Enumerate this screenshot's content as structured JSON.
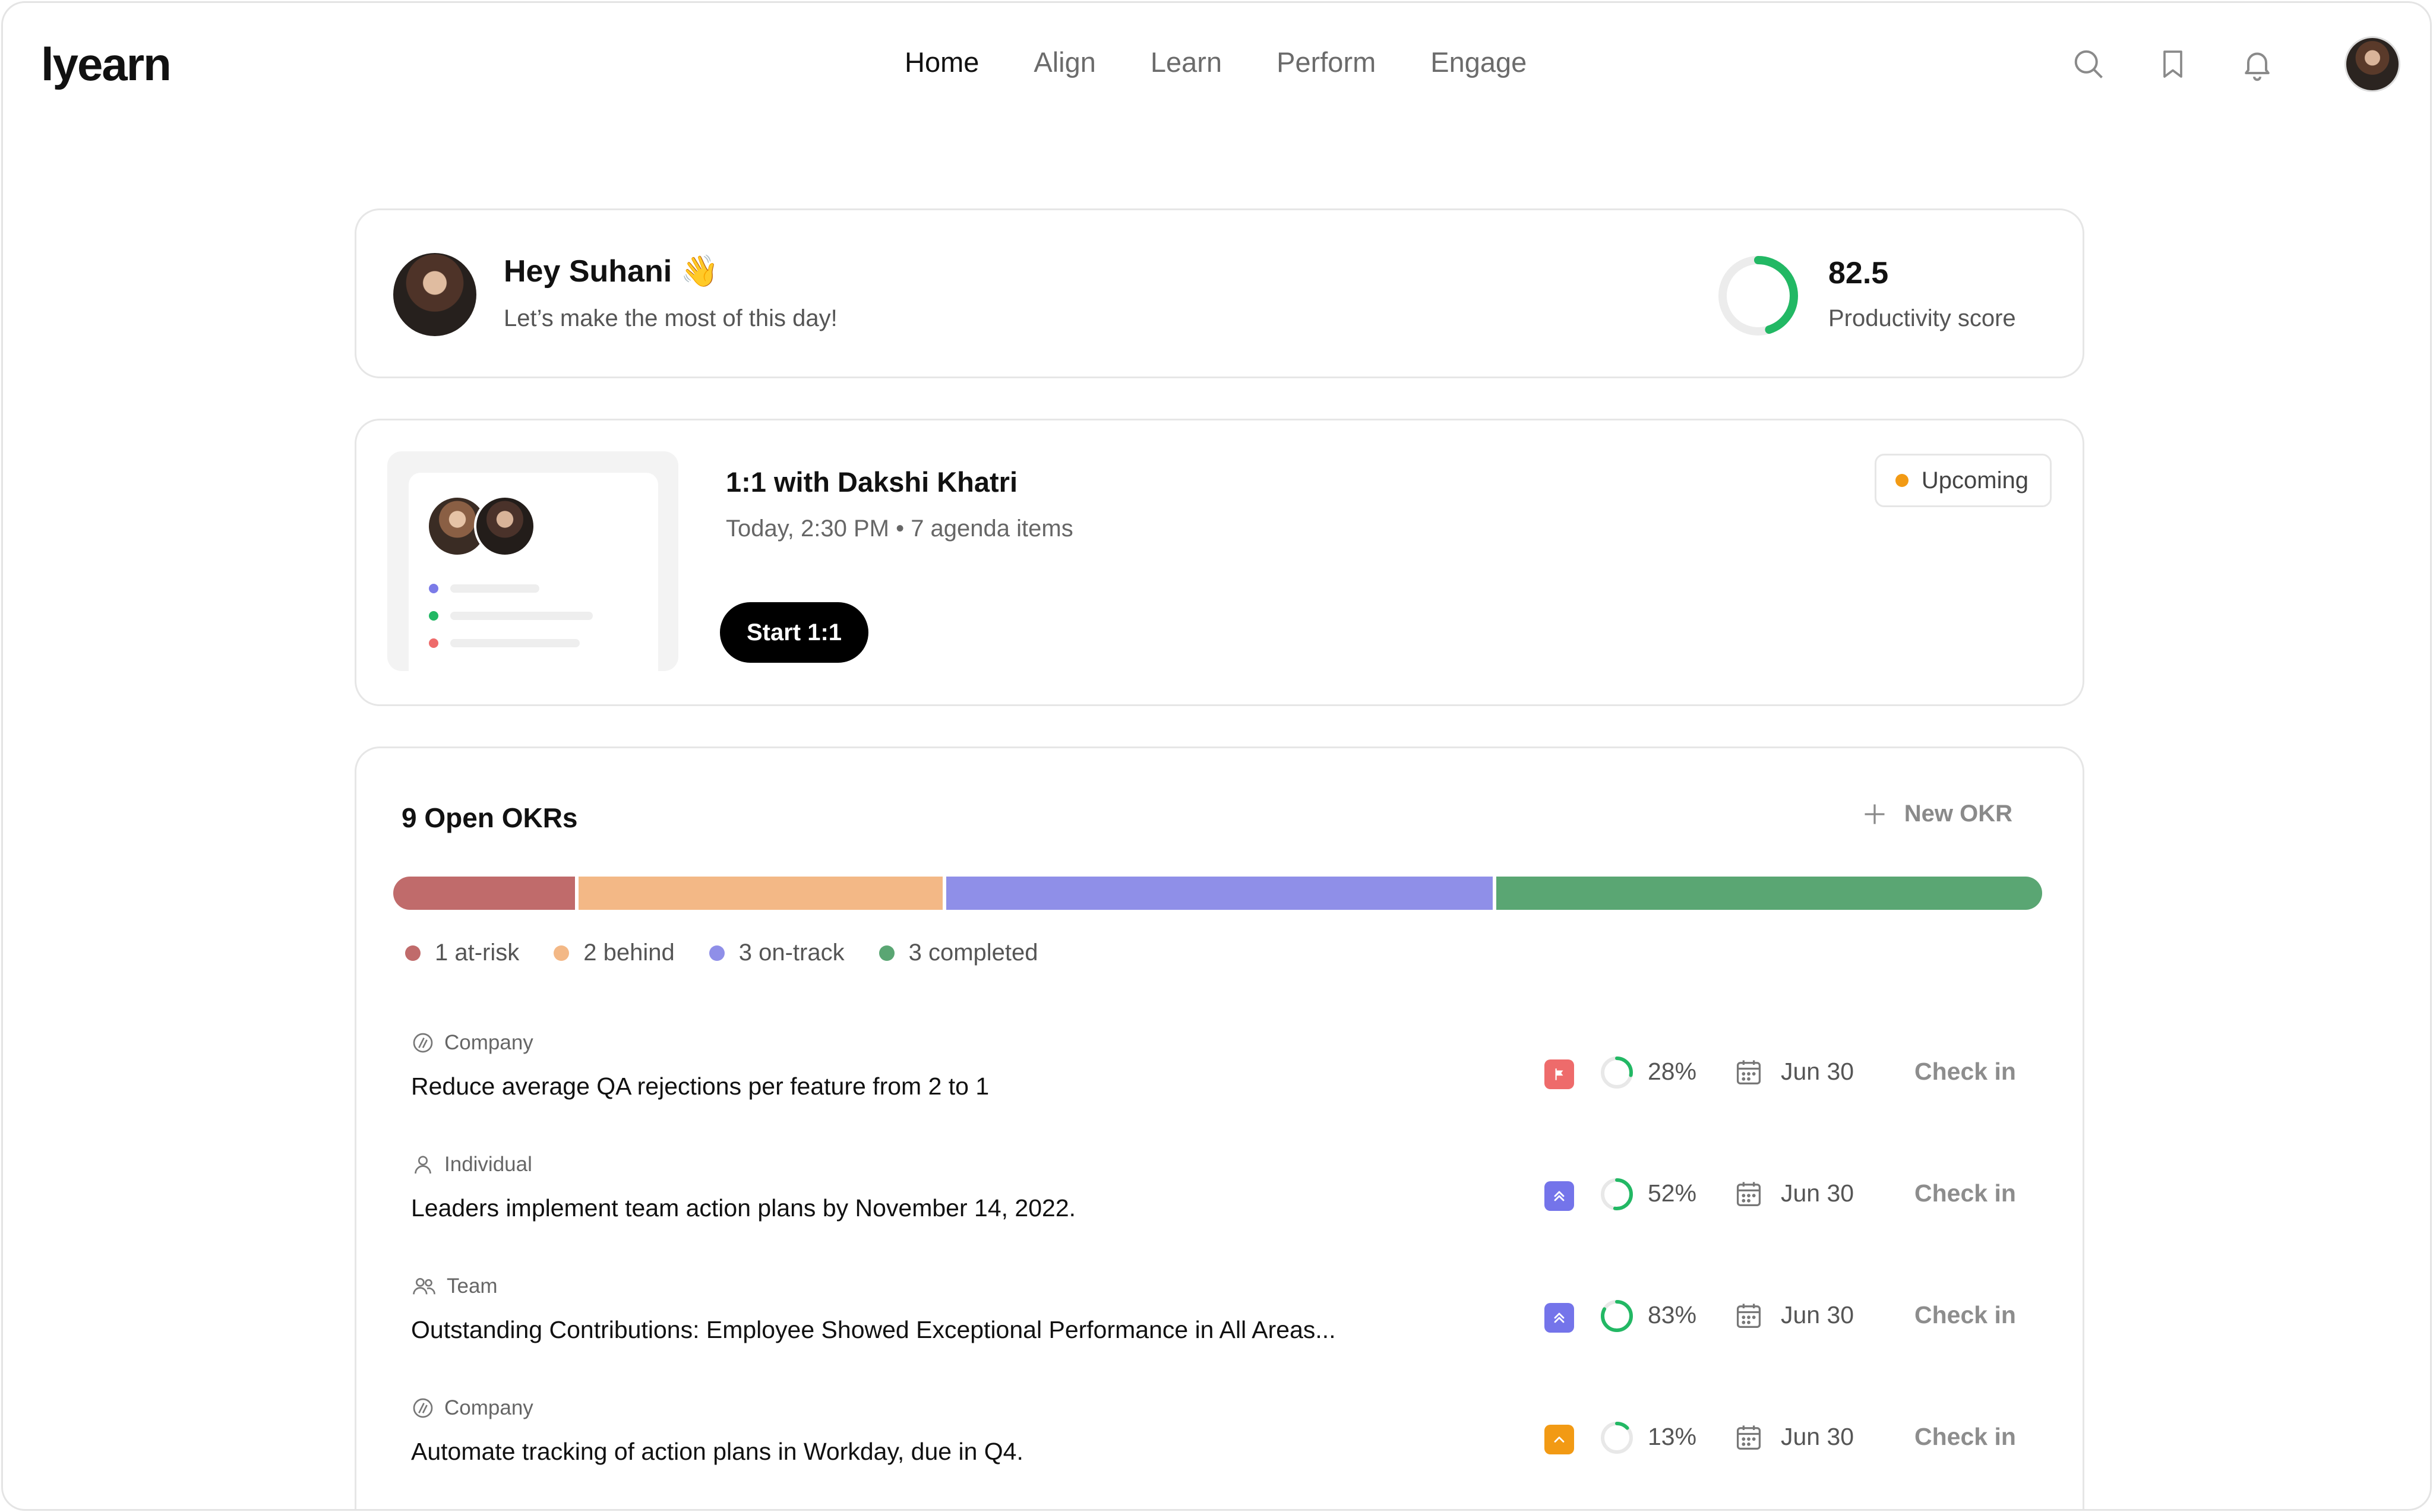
{
  "app": {
    "logo": "lyearn"
  },
  "nav": [
    {
      "label": "Home",
      "active": true
    },
    {
      "label": "Align",
      "active": false
    },
    {
      "label": "Learn",
      "active": false
    },
    {
      "label": "Perform",
      "active": false
    },
    {
      "label": "Engage",
      "active": false
    }
  ],
  "header_icons": [
    "search-icon",
    "bookmark-icon",
    "bell-icon",
    "user-avatar"
  ],
  "welcome": {
    "greeting": "Hey Suhani 👋",
    "subtitle": "Let’s make the most of this day!",
    "score": "82.5",
    "score_label": "Productivity score",
    "score_fraction": 0.45
  },
  "meeting": {
    "title": "1:1 with Dakshi Khatri",
    "subtitle": "Today, 2:30 PM • 7 agenda items",
    "button": "Start 1:1",
    "status": "Upcoming"
  },
  "okrs": {
    "title": "9 Open OKRs",
    "new_button": "New OKR",
    "segments": [
      {
        "label": "1 at-risk",
        "count": 1,
        "color": "#c06b6b"
      },
      {
        "label": "2 behind",
        "count": 2,
        "color": "#f3b886"
      },
      {
        "label": "3 on-track",
        "count": 3,
        "color": "#8f8fe8"
      },
      {
        "label": "3 completed",
        "count": 3,
        "color": "#5aa673"
      }
    ],
    "rows": [
      {
        "type": "Company",
        "type_icon": "company-icon",
        "title": "Reduce average QA rejections per feature from 2 to 1",
        "priority": "flag",
        "priority_color": "#ee6b6b",
        "percent": "28%",
        "progress": 0.28,
        "date": "Jun 30",
        "action": "Check in"
      },
      {
        "type": "Individual",
        "type_icon": "person-icon",
        "title": "Leaders implement team action plans by November 14, 2022.",
        "priority": "double-chevron-up",
        "priority_color": "#7474ea",
        "percent": "52%",
        "progress": 0.52,
        "date": "Jun 30",
        "action": "Check in"
      },
      {
        "type": "Team",
        "type_icon": "team-icon",
        "title": "Outstanding Contributions: Employee Showed Exceptional Performance in All Areas...",
        "priority": "double-chevron-up",
        "priority_color": "#7474ea",
        "percent": "83%",
        "progress": 0.83,
        "date": "Jun 30",
        "action": "Check in"
      },
      {
        "type": "Company",
        "type_icon": "company-icon",
        "title": "Automate tracking of action plans in Workday, due in Q4.",
        "priority": "chevron-up",
        "priority_color": "#f29a14",
        "percent": "13%",
        "progress": 0.13,
        "date": "Jun 30",
        "action": "Check in"
      }
    ]
  }
}
